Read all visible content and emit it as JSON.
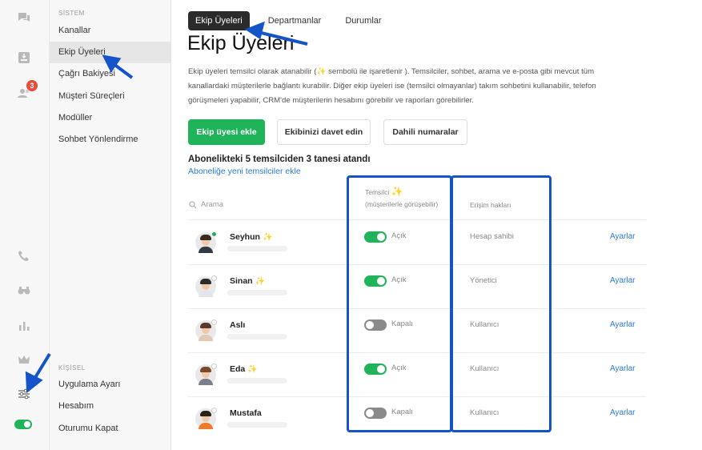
{
  "colors": {
    "accent_green": "#1fb35a",
    "link_blue": "#2a7ad4",
    "annotation_blue": "#1553c9"
  },
  "rail": {
    "icons": [
      "chat-icon",
      "inbox-icon",
      "contacts-icon",
      "phone-icon",
      "binoculars-icon",
      "bar-chart-icon",
      "crown-icon",
      "sliders-icon",
      "toggle-icon"
    ],
    "contacts_badge": "3"
  },
  "sidebar": {
    "section_system": "SİSTEM",
    "section_personal": "KİŞİSEL",
    "system_items": [
      {
        "label": "Kanallar"
      },
      {
        "label": "Ekip Üyeleri"
      },
      {
        "label": "Çağrı Bakiyesi"
      },
      {
        "label": "Müşteri Süreçleri"
      },
      {
        "label": "Modüller"
      },
      {
        "label": "Sohbet Yönlendirme"
      }
    ],
    "personal_items": [
      {
        "label": "Uygulama Ayarı"
      },
      {
        "label": "Hesabım"
      },
      {
        "label": "Oturumu Kapat"
      }
    ]
  },
  "tabs": [
    {
      "label": "Ekip Üyeleri"
    },
    {
      "label": "Departmanlar"
    },
    {
      "label": "Durumlar"
    }
  ],
  "page": {
    "title": "Ekip Üyeleri",
    "description_part1": "Ekip üyeleri temsilci olarak atanabilir (",
    "description_spark": "✨",
    "description_part2": " sembolü ile işaretlenir ). Temsilciler, sohbet, arama ve e-posta gibi mevcut tüm kanallardaki müşterilerle bağlantı kurabilir. Diğer ekip üyeleri ise (temsilci olmayanlar) takım sohbetini kullanabilir, telefon görüşmeleri yapabilir, CRM'de müşterilerin hesabını görebilir ve raporları görebilirler."
  },
  "buttons": {
    "add_member": "Ekip üyesi ekle",
    "invite_team": "Ekibinizi davet edin",
    "extensions": "Dahili numaralar"
  },
  "subscription": {
    "summary": "Abonelikteki 5 temsilciden 3 tanesi atandı",
    "add_link": "Aboneliğe yeni temsilciler ekle"
  },
  "table": {
    "search_placeholder": "Arama",
    "col_agent": "Temsilci",
    "col_agent_spark": "✨",
    "col_agent_sub": "(müşterilerle görüşebilir)",
    "col_access": "Erişim hakları",
    "settings_label": "Ayarlar",
    "rows": [
      {
        "name": "Seyhun",
        "spark": "✨",
        "agent_on": true,
        "toggle_label": "Açık",
        "role": "Hesap sahibi",
        "online": true
      },
      {
        "name": "Sinan",
        "spark": "✨",
        "agent_on": true,
        "toggle_label": "Açık",
        "role": "Yönetici",
        "online": false
      },
      {
        "name": "Aslı",
        "spark": "",
        "agent_on": false,
        "toggle_label": "Kapalı",
        "role": "Kullanıcı",
        "online": false
      },
      {
        "name": "Eda",
        "spark": "✨",
        "agent_on": true,
        "toggle_label": "Açık",
        "role": "Kullanıcı",
        "online": false
      },
      {
        "name": "Mustafa",
        "spark": "",
        "agent_on": false,
        "toggle_label": "Kapalı",
        "role": "Kullanıcı",
        "online": false
      }
    ]
  }
}
